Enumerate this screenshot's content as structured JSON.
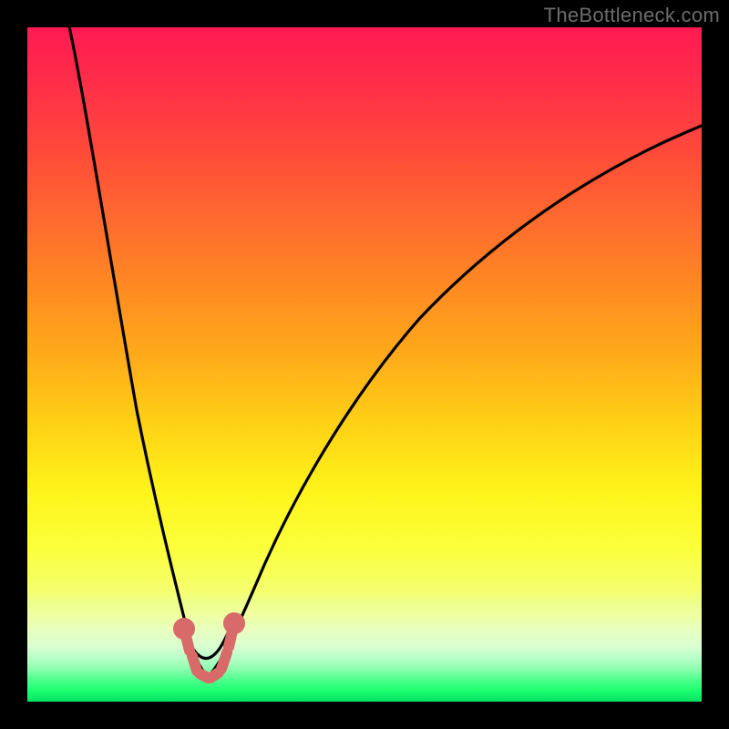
{
  "watermark": "TheBottleneck.com",
  "colors": {
    "frame": "#000000",
    "curve_stroke": "#000000",
    "marker_fill": "#d86a6a",
    "marker_stroke": "#c25858",
    "gradient": [
      "#ff1a52",
      "#ff6a2e",
      "#ffd016",
      "#fbff3a",
      "#1eff72"
    ]
  },
  "chart_data": {
    "type": "line",
    "title": "",
    "xlabel": "",
    "ylabel": "",
    "xlim": [
      0,
      100
    ],
    "ylim": [
      0,
      100
    ],
    "grid": false,
    "notes": "Background is a vertical red→yellow→green heat gradient indicating bottleneck severity (red high, green low). Two black curves descend from the top and meet near the x≈25 minimum; short pink marker segments sit at the trough. Axis tick labels are not shown so values are approximate positions in percent of the plot area.",
    "series": [
      {
        "name": "left-curve",
        "x": [
          6,
          8,
          10,
          12,
          14,
          16,
          18,
          20,
          22,
          23,
          24,
          25,
          26,
          27
        ],
        "y": [
          100,
          90,
          80,
          69,
          58,
          47,
          37,
          27,
          18,
          14,
          11,
          8,
          6,
          5
        ]
      },
      {
        "name": "right-curve",
        "x": [
          27,
          28,
          30,
          33,
          37,
          42,
          48,
          55,
          63,
          72,
          82,
          92,
          100
        ],
        "y": [
          5,
          7,
          11,
          18,
          27,
          37,
          47,
          56,
          64,
          71,
          77,
          82,
          86
        ]
      },
      {
        "name": "trough-markers",
        "style": "thick-pink-dots-and-short-segments",
        "x": [
          22.5,
          23.5,
          24.5,
          25.5,
          26.5,
          27.5,
          28.5
        ],
        "y": [
          10,
          7,
          5,
          4,
          4,
          5,
          8
        ]
      }
    ]
  }
}
